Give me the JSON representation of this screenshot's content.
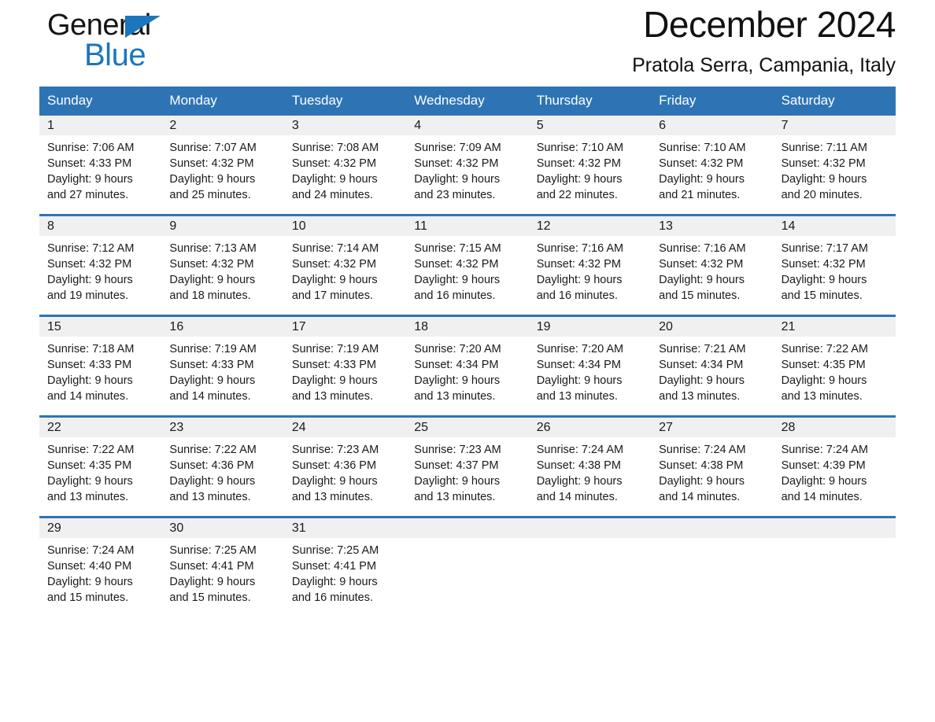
{
  "brand": {
    "name_top": "General",
    "name_bottom": "Blue",
    "triangle_color": "#1c76bc"
  },
  "header": {
    "title": "December 2024",
    "subtitle": "Pratola Serra, Campania, Italy"
  },
  "theme": {
    "header_blue": "#2e74b5",
    "daynum_band": "#f0f0f0",
    "text": "#1a1a1a"
  },
  "weekday_names": [
    "Sunday",
    "Monday",
    "Tuesday",
    "Wednesday",
    "Thursday",
    "Friday",
    "Saturday"
  ],
  "weeks": [
    [
      {
        "day": "1",
        "sunrise": "Sunrise: 7:06 AM",
        "sunset": "Sunset: 4:33 PM",
        "daylight_line1": "Daylight: 9 hours",
        "daylight_line2": "and 27 minutes."
      },
      {
        "day": "2",
        "sunrise": "Sunrise: 7:07 AM",
        "sunset": "Sunset: 4:32 PM",
        "daylight_line1": "Daylight: 9 hours",
        "daylight_line2": "and 25 minutes."
      },
      {
        "day": "3",
        "sunrise": "Sunrise: 7:08 AM",
        "sunset": "Sunset: 4:32 PM",
        "daylight_line1": "Daylight: 9 hours",
        "daylight_line2": "and 24 minutes."
      },
      {
        "day": "4",
        "sunrise": "Sunrise: 7:09 AM",
        "sunset": "Sunset: 4:32 PM",
        "daylight_line1": "Daylight: 9 hours",
        "daylight_line2": "and 23 minutes."
      },
      {
        "day": "5",
        "sunrise": "Sunrise: 7:10 AM",
        "sunset": "Sunset: 4:32 PM",
        "daylight_line1": "Daylight: 9 hours",
        "daylight_line2": "and 22 minutes."
      },
      {
        "day": "6",
        "sunrise": "Sunrise: 7:10 AM",
        "sunset": "Sunset: 4:32 PM",
        "daylight_line1": "Daylight: 9 hours",
        "daylight_line2": "and 21 minutes."
      },
      {
        "day": "7",
        "sunrise": "Sunrise: 7:11 AM",
        "sunset": "Sunset: 4:32 PM",
        "daylight_line1": "Daylight: 9 hours",
        "daylight_line2": "and 20 minutes."
      }
    ],
    [
      {
        "day": "8",
        "sunrise": "Sunrise: 7:12 AM",
        "sunset": "Sunset: 4:32 PM",
        "daylight_line1": "Daylight: 9 hours",
        "daylight_line2": "and 19 minutes."
      },
      {
        "day": "9",
        "sunrise": "Sunrise: 7:13 AM",
        "sunset": "Sunset: 4:32 PM",
        "daylight_line1": "Daylight: 9 hours",
        "daylight_line2": "and 18 minutes."
      },
      {
        "day": "10",
        "sunrise": "Sunrise: 7:14 AM",
        "sunset": "Sunset: 4:32 PM",
        "daylight_line1": "Daylight: 9 hours",
        "daylight_line2": "and 17 minutes."
      },
      {
        "day": "11",
        "sunrise": "Sunrise: 7:15 AM",
        "sunset": "Sunset: 4:32 PM",
        "daylight_line1": "Daylight: 9 hours",
        "daylight_line2": "and 16 minutes."
      },
      {
        "day": "12",
        "sunrise": "Sunrise: 7:16 AM",
        "sunset": "Sunset: 4:32 PM",
        "daylight_line1": "Daylight: 9 hours",
        "daylight_line2": "and 16 minutes."
      },
      {
        "day": "13",
        "sunrise": "Sunrise: 7:16 AM",
        "sunset": "Sunset: 4:32 PM",
        "daylight_line1": "Daylight: 9 hours",
        "daylight_line2": "and 15 minutes."
      },
      {
        "day": "14",
        "sunrise": "Sunrise: 7:17 AM",
        "sunset": "Sunset: 4:32 PM",
        "daylight_line1": "Daylight: 9 hours",
        "daylight_line2": "and 15 minutes."
      }
    ],
    [
      {
        "day": "15",
        "sunrise": "Sunrise: 7:18 AM",
        "sunset": "Sunset: 4:33 PM",
        "daylight_line1": "Daylight: 9 hours",
        "daylight_line2": "and 14 minutes."
      },
      {
        "day": "16",
        "sunrise": "Sunrise: 7:19 AM",
        "sunset": "Sunset: 4:33 PM",
        "daylight_line1": "Daylight: 9 hours",
        "daylight_line2": "and 14 minutes."
      },
      {
        "day": "17",
        "sunrise": "Sunrise: 7:19 AM",
        "sunset": "Sunset: 4:33 PM",
        "daylight_line1": "Daylight: 9 hours",
        "daylight_line2": "and 13 minutes."
      },
      {
        "day": "18",
        "sunrise": "Sunrise: 7:20 AM",
        "sunset": "Sunset: 4:34 PM",
        "daylight_line1": "Daylight: 9 hours",
        "daylight_line2": "and 13 minutes."
      },
      {
        "day": "19",
        "sunrise": "Sunrise: 7:20 AM",
        "sunset": "Sunset: 4:34 PM",
        "daylight_line1": "Daylight: 9 hours",
        "daylight_line2": "and 13 minutes."
      },
      {
        "day": "20",
        "sunrise": "Sunrise: 7:21 AM",
        "sunset": "Sunset: 4:34 PM",
        "daylight_line1": "Daylight: 9 hours",
        "daylight_line2": "and 13 minutes."
      },
      {
        "day": "21",
        "sunrise": "Sunrise: 7:22 AM",
        "sunset": "Sunset: 4:35 PM",
        "daylight_line1": "Daylight: 9 hours",
        "daylight_line2": "and 13 minutes."
      }
    ],
    [
      {
        "day": "22",
        "sunrise": "Sunrise: 7:22 AM",
        "sunset": "Sunset: 4:35 PM",
        "daylight_line1": "Daylight: 9 hours",
        "daylight_line2": "and 13 minutes."
      },
      {
        "day": "23",
        "sunrise": "Sunrise: 7:22 AM",
        "sunset": "Sunset: 4:36 PM",
        "daylight_line1": "Daylight: 9 hours",
        "daylight_line2": "and 13 minutes."
      },
      {
        "day": "24",
        "sunrise": "Sunrise: 7:23 AM",
        "sunset": "Sunset: 4:36 PM",
        "daylight_line1": "Daylight: 9 hours",
        "daylight_line2": "and 13 minutes."
      },
      {
        "day": "25",
        "sunrise": "Sunrise: 7:23 AM",
        "sunset": "Sunset: 4:37 PM",
        "daylight_line1": "Daylight: 9 hours",
        "daylight_line2": "and 13 minutes."
      },
      {
        "day": "26",
        "sunrise": "Sunrise: 7:24 AM",
        "sunset": "Sunset: 4:38 PM",
        "daylight_line1": "Daylight: 9 hours",
        "daylight_line2": "and 14 minutes."
      },
      {
        "day": "27",
        "sunrise": "Sunrise: 7:24 AM",
        "sunset": "Sunset: 4:38 PM",
        "daylight_line1": "Daylight: 9 hours",
        "daylight_line2": "and 14 minutes."
      },
      {
        "day": "28",
        "sunrise": "Sunrise: 7:24 AM",
        "sunset": "Sunset: 4:39 PM",
        "daylight_line1": "Daylight: 9 hours",
        "daylight_line2": "and 14 minutes."
      }
    ],
    [
      {
        "day": "29",
        "sunrise": "Sunrise: 7:24 AM",
        "sunset": "Sunset: 4:40 PM",
        "daylight_line1": "Daylight: 9 hours",
        "daylight_line2": "and 15 minutes."
      },
      {
        "day": "30",
        "sunrise": "Sunrise: 7:25 AM",
        "sunset": "Sunset: 4:41 PM",
        "daylight_line1": "Daylight: 9 hours",
        "daylight_line2": "and 15 minutes."
      },
      {
        "day": "31",
        "sunrise": "Sunrise: 7:25 AM",
        "sunset": "Sunset: 4:41 PM",
        "daylight_line1": "Daylight: 9 hours",
        "daylight_line2": "and 16 minutes."
      },
      {
        "day": "",
        "sunrise": "",
        "sunset": "",
        "daylight_line1": "",
        "daylight_line2": ""
      },
      {
        "day": "",
        "sunrise": "",
        "sunset": "",
        "daylight_line1": "",
        "daylight_line2": ""
      },
      {
        "day": "",
        "sunrise": "",
        "sunset": "",
        "daylight_line1": "",
        "daylight_line2": ""
      },
      {
        "day": "",
        "sunrise": "",
        "sunset": "",
        "daylight_line1": "",
        "daylight_line2": ""
      }
    ]
  ]
}
